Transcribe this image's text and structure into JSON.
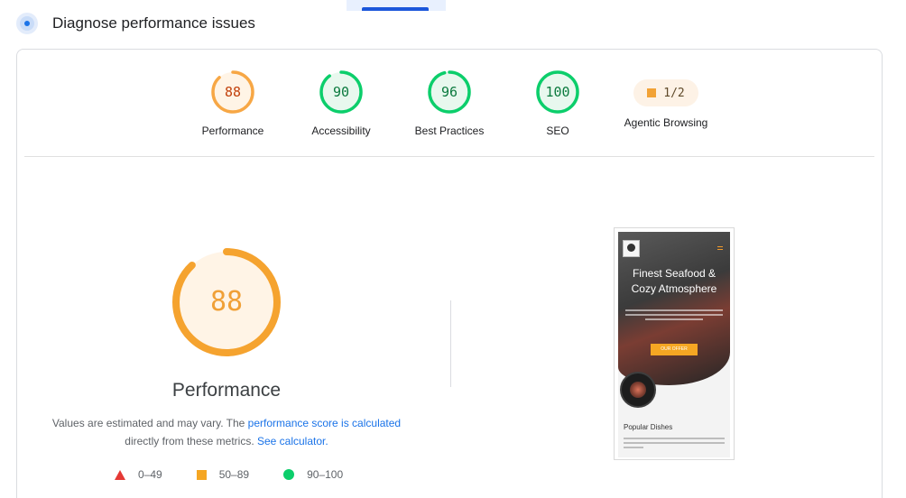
{
  "header": {
    "title": "Diagnose performance issues"
  },
  "categories": [
    {
      "score": "88",
      "label": "Performance",
      "fraction": 0.88,
      "status": "average"
    },
    {
      "score": "90",
      "label": "Accessibility",
      "fraction": 0.9,
      "status": "pass"
    },
    {
      "score": "96",
      "label": "Best Practices",
      "fraction": 0.96,
      "status": "pass"
    },
    {
      "score": "100",
      "label": "SEO",
      "fraction": 1.0,
      "status": "pass"
    }
  ],
  "agentic": {
    "value": "1/2",
    "label": "Agentic Browsing"
  },
  "performance": {
    "score": "88",
    "fraction": 0.88,
    "title": "Performance",
    "desc_prefix": "Values are estimated and may vary. The ",
    "desc_link": "performance score is calculated",
    "desc_middle": " directly from these metrics. ",
    "desc_link2": "See calculator."
  },
  "legend": {
    "fail": "0–49",
    "average": "50–89",
    "pass": "90–100"
  },
  "screenshot": {
    "hero_title": "Finest Seafood & Cozy Atmosphere",
    "button": "OUR OFFER",
    "section_title": "Popular Dishes"
  },
  "colors": {
    "pass": "#0cce6b",
    "average": "#ffa400",
    "fail": "#ff4e42",
    "link": "#1a73e8"
  }
}
